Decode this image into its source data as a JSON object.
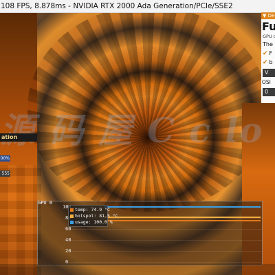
{
  "titlebar": {
    "text": "108 FPS, 8.878ms - NVIDIA RTX 2000 Ada Generation/PCIe/SSE2"
  },
  "watermark": {
    "text": "源 码 屋 C c lo"
  },
  "left_panel": {
    "list_label": "ation",
    "value_1": "00%",
    "value_2": "555"
  },
  "side_panel": {
    "header": "▼ De",
    "title": "Fu",
    "gpu_text": "GPU o",
    "desc": "The",
    "checks": [
      {
        "icon": "checkmark-icon",
        "label": "F"
      },
      {
        "icon": "checkmark-icon",
        "label": "b"
      }
    ],
    "button_label": "V",
    "osi_label": "OSI",
    "osi_value": "0"
  },
  "gpu_monitor": {
    "title": "GPU 0",
    "legend": [
      {
        "name": "temp: 74.9 °C",
        "color": "#e07a1a"
      },
      {
        "name": "hotspot: 81.5 °C",
        "color": "#f0b040"
      },
      {
        "name": "usage: 100.0 %",
        "color": "#3aa0e8"
      }
    ]
  },
  "chart_data": {
    "type": "line",
    "title": "GPU 0",
    "xlabel": "",
    "ylabel": "",
    "ylim": [
      0,
      100
    ],
    "yticks": [
      "100",
      "80",
      "60",
      "40",
      "20",
      "0"
    ],
    "grid": true,
    "legend_position": "top-left",
    "series": [
      {
        "name": "temp: 74.9 °C",
        "values": [
          74.9,
          74.9
        ],
        "color": "#e07a1a"
      },
      {
        "name": "hotspot: 81.5 °C",
        "values": [
          81.5,
          81.5
        ],
        "color": "#f0b040"
      },
      {
        "name": "usage: 100.0 %",
        "values": [
          100.0,
          100.0
        ],
        "color": "#3aa0e8"
      }
    ]
  },
  "colors": {
    "accent": "#e0861a",
    "panel_bg": "#fafafa"
  }
}
